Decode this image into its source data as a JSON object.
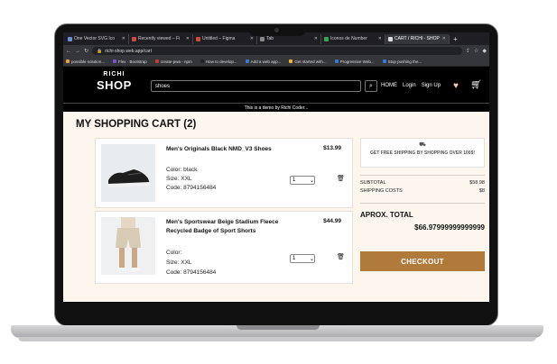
{
  "browser": {
    "tabs": [
      {
        "label": "One Vector SVG Ico"
      },
      {
        "label": "Recently viewed – Fi"
      },
      {
        "label": "Untitled – Figma"
      },
      {
        "label": "Tab"
      },
      {
        "label": "Iconos de Number"
      },
      {
        "label": "CART / RICHI - SHOP",
        "active": true
      }
    ],
    "new_tab": "+",
    "url": "richi-shop.web.app/cart",
    "bookmarks": [
      {
        "label": "possible solution..."
      },
      {
        "label": "Flex · Bootstrap"
      },
      {
        "label": "create-pwa - npm"
      },
      {
        "label": "How to develop..."
      },
      {
        "label": "Add a web app..."
      },
      {
        "label": "Get started with..."
      },
      {
        "label": "Progressive Web..."
      },
      {
        "label": "Stop pushing the..."
      }
    ]
  },
  "header": {
    "logo_top": "RICHI",
    "logo_bottom": "SHOP",
    "search_value": "shoes",
    "nav": {
      "home": "HOME",
      "login": "Login",
      "signup": "Sign Up"
    },
    "demo_notice": "This is a demo by Richi Coder..."
  },
  "cart": {
    "title": "MY SHOPPING CART (2)",
    "items": [
      {
        "name": "Men's Originals Black NMD_V3 Shoes",
        "color": "Color: black",
        "size": "Size: XXL",
        "code": "Code: 8794156484",
        "price": "$13.99",
        "qty": "1"
      },
      {
        "name": "Men's Sportswear Beige Stadium Fleece Recycled Badge of Sport Shorts",
        "color": "Color:",
        "size": "Size: XXL",
        "code": "Code: 8794156484",
        "price": "$44.99",
        "qty": "1"
      }
    ]
  },
  "summary": {
    "shipping_promo": "GET FREE SHIPPING BY SHOPPING OVER 100$!",
    "subtotal_label": "SUBTOTAL",
    "subtotal_value": "$58.98",
    "shipping_label": "SHIPPING COSTS",
    "shipping_value": "$8",
    "total_label": "APROX. TOTAL",
    "total_value": "$66.97999999999999",
    "checkout_label": "CHECKOUT"
  },
  "colors": {
    "accent": "#b07a3a",
    "page_bg": "#fdf6ee",
    "header_bg": "#000000"
  }
}
